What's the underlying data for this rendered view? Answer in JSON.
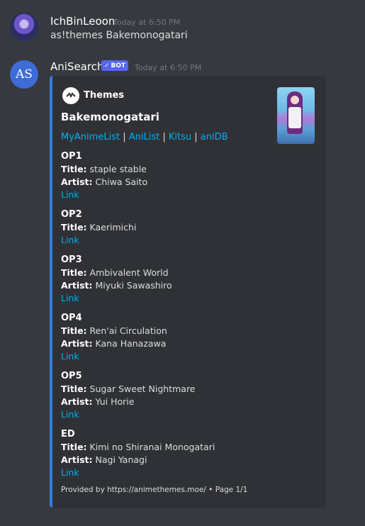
{
  "messages": [
    {
      "username": "IchBinLeoon",
      "timestamp": "Today at 6:50 PM",
      "content": "as!themes Bakemonogatari"
    },
    {
      "username": "AniSearch",
      "avatar_initials": "AS",
      "badge": "BOT",
      "timestamp": "Today at 6:50 PM"
    }
  ],
  "embed": {
    "accent_color": "#2f7de1",
    "author": "Themes",
    "title": "Bakemonogatari",
    "links": [
      "MyAnimeList",
      "AniList",
      "Kitsu",
      "aniDB"
    ],
    "link_separator": "|",
    "fields": [
      {
        "name": "OP1",
        "title_label": "Title:",
        "title": "staple stable",
        "artist_label": "Artist:",
        "artist": "Chiwa Saito",
        "link": "Link"
      },
      {
        "name": "OP2",
        "title_label": "Title:",
        "title": "Kaerimichi",
        "link": "Link"
      },
      {
        "name": "OP3",
        "title_label": "Title:",
        "title": "Ambivalent World",
        "artist_label": "Artist:",
        "artist": "Miyuki Sawashiro",
        "link": "Link"
      },
      {
        "name": "OP4",
        "title_label": "Title:",
        "title": "Ren'ai Circulation",
        "artist_label": "Artist:",
        "artist": "Kana Hanazawa",
        "link": "Link"
      },
      {
        "name": "OP5",
        "title_label": "Title:",
        "title": "Sugar Sweet Nightmare",
        "artist_label": "Artist:",
        "artist": "Yui Horie",
        "link": "Link"
      },
      {
        "name": "ED",
        "title_label": "Title:",
        "title": "Kimi no Shiranai Monogatari",
        "artist_label": "Artist:",
        "artist": "Nagi Yanagi",
        "link": "Link"
      }
    ],
    "footer": "Provided by https://animethemes.moe/ • Page 1/1"
  },
  "colors": {
    "background": "#36393f",
    "embed_background": "#2f3136",
    "link": "#00aff4",
    "badge": "#5865f2"
  }
}
